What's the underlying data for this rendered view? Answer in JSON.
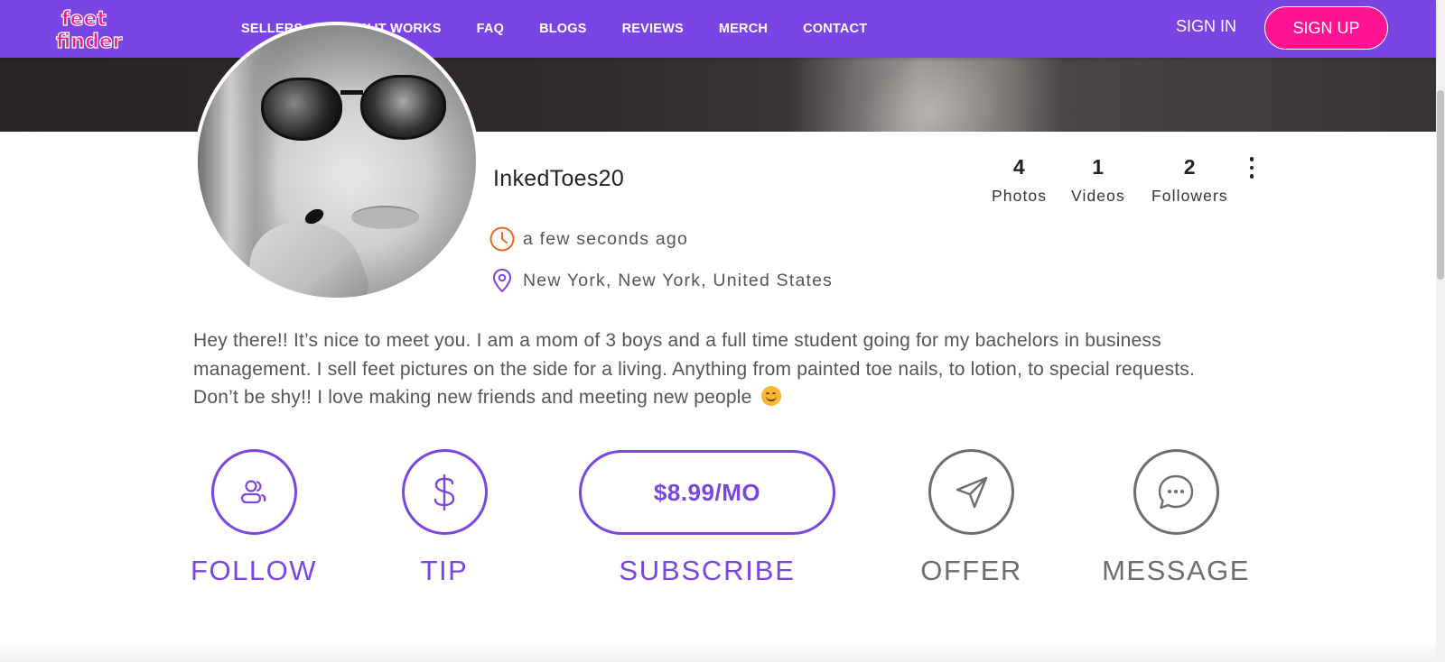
{
  "brand": {
    "logo_line1": "feet",
    "logo_line2": "finder"
  },
  "nav": {
    "links": [
      "SELLERS",
      "HOW IT WORKS",
      "FAQ",
      "BLOGS",
      "REVIEWS",
      "MERCH",
      "CONTACT"
    ],
    "sign_in": "SIGN IN",
    "sign_up": "SIGN UP"
  },
  "profile": {
    "username": "InkedToes20",
    "last_active": "a few seconds ago",
    "location": "New York, New York, United States",
    "stats": [
      {
        "value": "4",
        "label": "Photos"
      },
      {
        "value": "1",
        "label": "Videos"
      },
      {
        "value": "2",
        "label": "Followers"
      }
    ],
    "bio": "Hey there!! It’s nice to meet you. I am a mom of 3 boys and a full time student going for my bachelors in business management. I sell feet pictures on the side for a living. Anything from painted toe nails, to lotion, to special requests. Don’t be shy!! I love making new friends and meeting new people"
  },
  "actions": {
    "follow": "FOLLOW",
    "tip": "TIP",
    "subscribe_price": "$8.99/MO",
    "subscribe": "SUBSCRIBE",
    "offer": "OFFER",
    "message": "MESSAGE"
  },
  "colors": {
    "brand_purple": "#7b44e4",
    "brand_pink": "#ff1493",
    "clock_orange": "#f2641e",
    "muted_grey": "#6d6d6d"
  },
  "icons": {
    "follow": "users-icon",
    "tip": "dollar-icon",
    "offer": "send-icon",
    "message": "chat-bubble-icon",
    "time": "clock-icon",
    "location": "map-pin-icon",
    "menu": "kebab-menu-icon"
  }
}
